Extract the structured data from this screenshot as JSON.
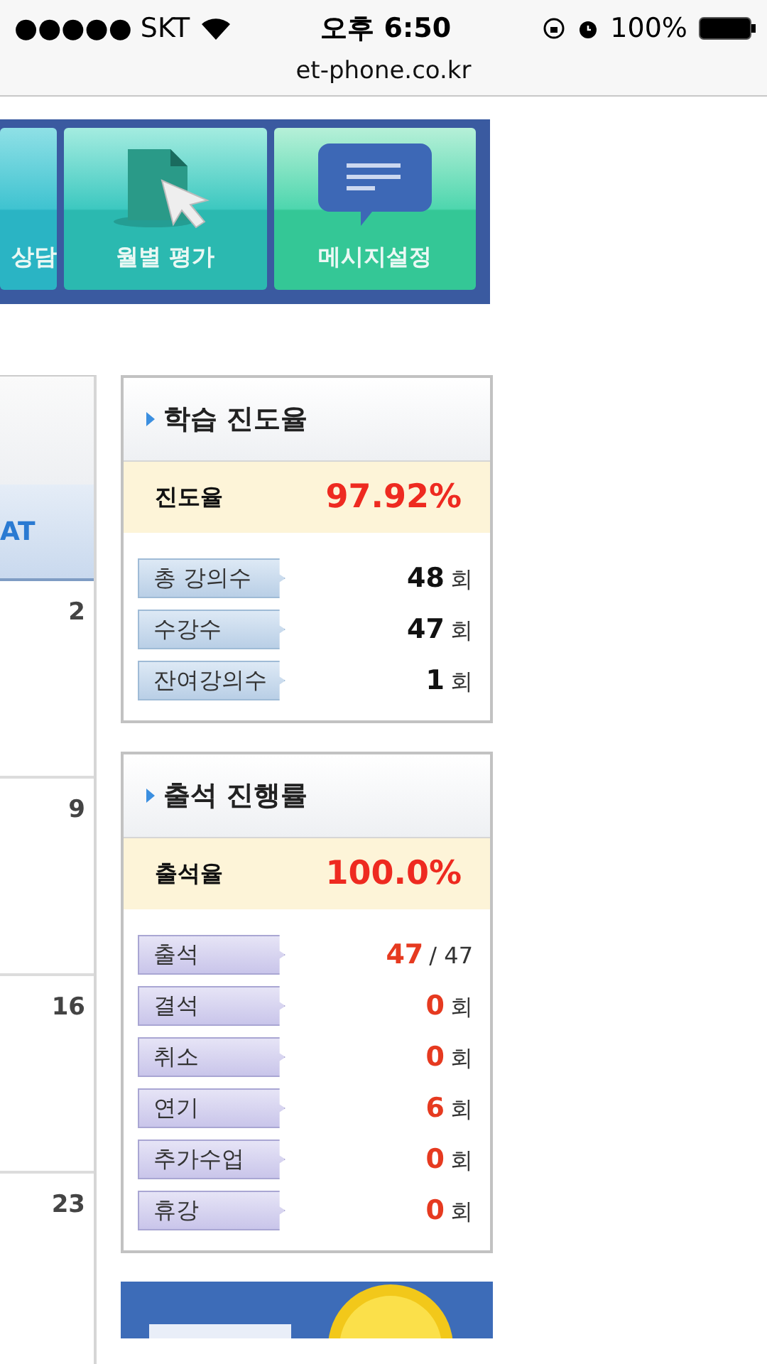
{
  "status_bar": {
    "carrier": "●●●●● SKT",
    "time": "오후 6:50",
    "battery": "100%"
  },
  "address_bar": {
    "url": "et-phone.co.kr"
  },
  "menu": [
    {
      "label": "상담",
      "kind": "partial"
    },
    {
      "label": "월별 평가",
      "kind": "document"
    },
    {
      "label": "메시지설정",
      "kind": "message"
    }
  ],
  "calendar": {
    "column_header": "AT",
    "days": [
      "2",
      "9",
      "16",
      "23"
    ]
  },
  "panels": [
    {
      "title": "학습 진도율",
      "summary_label": "진도율",
      "summary_value": "97.92%",
      "kind": "progress",
      "rows": [
        {
          "label": "총 강의수",
          "value": "48",
          "unit": "회",
          "highlight": false
        },
        {
          "label": "수강수",
          "value": "47",
          "unit": "회",
          "highlight": false
        },
        {
          "label": "잔여강의수",
          "value": "1",
          "unit": "회",
          "highlight": false
        }
      ]
    },
    {
      "title": "출석 진행률",
      "summary_label": "출석율",
      "summary_value": "100.0%",
      "kind": "attendance",
      "rows": [
        {
          "label": "출석",
          "value": "47",
          "unit": "/ 47",
          "highlight": true
        },
        {
          "label": "결석",
          "value": "0",
          "unit": "회",
          "highlight": true
        },
        {
          "label": "취소",
          "value": "0",
          "unit": "회",
          "highlight": true
        },
        {
          "label": "연기",
          "value": "6",
          "unit": "회",
          "highlight": true
        },
        {
          "label": "추가수업",
          "value": "0",
          "unit": "회",
          "highlight": true
        },
        {
          "label": "휴강",
          "value": "0",
          "unit": "회",
          "highlight": true
        }
      ]
    }
  ]
}
